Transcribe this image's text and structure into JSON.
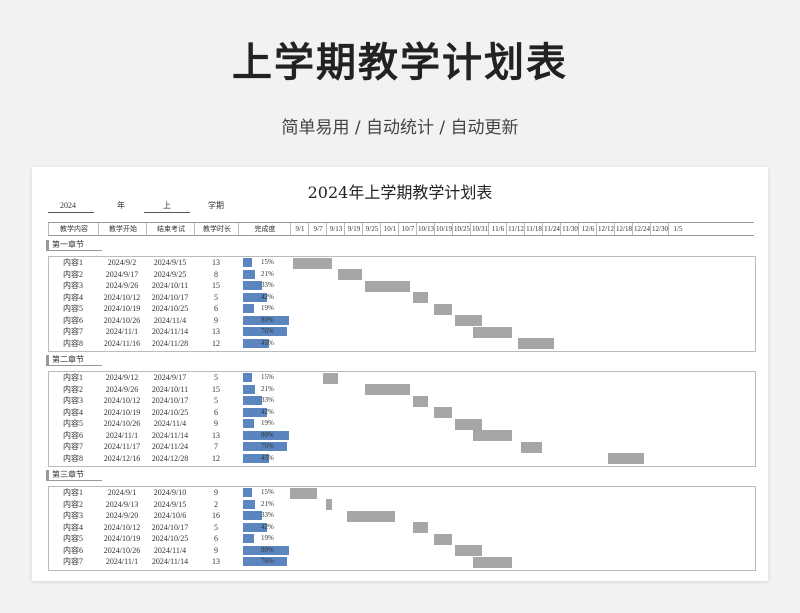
{
  "header": {
    "main_title": "上学期教学计划表",
    "subtitle": "简单易用 / 自动统计 / 自动更新"
  },
  "sheet": {
    "title": "2024年上学期教学计划表",
    "year_value": "2024",
    "year_label": "年",
    "term_value": "上",
    "term_label": "学期",
    "columns": [
      "教学内容",
      "教学开始",
      "结束考试",
      "教学时长",
      "完成度"
    ],
    "timeline_dates": [
      "9/1",
      "9/7",
      "9/13",
      "9/19",
      "9/25",
      "10/1",
      "10/7",
      "10/13",
      "10/19",
      "10/25",
      "10/31",
      "11/6",
      "11/12",
      "11/18",
      "11/24",
      "11/30",
      "12/6",
      "12/12",
      "12/18",
      "12/24",
      "12/30",
      "1/5"
    ],
    "sections": [
      {
        "name": "第一章节",
        "rows": [
          {
            "content": "内容1",
            "start": "2024/9/2",
            "end": "2024/9/15",
            "duration": "13",
            "progress": "15%",
            "progress_value": 0.15
          },
          {
            "content": "内容2",
            "start": "2024/9/17",
            "end": "2024/9/25",
            "duration": "8",
            "progress": "21%",
            "progress_value": 0.21
          },
          {
            "content": "内容3",
            "start": "2024/9/26",
            "end": "2024/10/11",
            "duration": "15",
            "progress": "33%",
            "progress_value": 0.33
          },
          {
            "content": "内容4",
            "start": "2024/10/12",
            "end": "2024/10/17",
            "duration": "5",
            "progress": "42%",
            "progress_value": 0.42
          },
          {
            "content": "内容5",
            "start": "2024/10/19",
            "end": "2024/10/25",
            "duration": "6",
            "progress": "19%",
            "progress_value": 0.19
          },
          {
            "content": "内容6",
            "start": "2024/10/26",
            "end": "2024/11/4",
            "duration": "9",
            "progress": "80%",
            "progress_value": 0.8
          },
          {
            "content": "内容7",
            "start": "2024/11/1",
            "end": "2024/11/14",
            "duration": "13",
            "progress": "76%",
            "progress_value": 0.76
          },
          {
            "content": "内容8",
            "start": "2024/11/16",
            "end": "2024/11/28",
            "duration": "12",
            "progress": "45%",
            "progress_value": 0.45
          }
        ]
      },
      {
        "name": "第二章节",
        "rows": [
          {
            "content": "内容1",
            "start": "2024/9/12",
            "end": "2024/9/17",
            "duration": "5",
            "progress": "15%",
            "progress_value": 0.15
          },
          {
            "content": "内容2",
            "start": "2024/9/26",
            "end": "2024/10/11",
            "duration": "15",
            "progress": "21%",
            "progress_value": 0.21
          },
          {
            "content": "内容3",
            "start": "2024/10/12",
            "end": "2024/10/17",
            "duration": "5",
            "progress": "33%",
            "progress_value": 0.33
          },
          {
            "content": "内容4",
            "start": "2024/10/19",
            "end": "2024/10/25",
            "duration": "6",
            "progress": "42%",
            "progress_value": 0.42
          },
          {
            "content": "内容5",
            "start": "2024/10/26",
            "end": "2024/11/4",
            "duration": "9",
            "progress": "19%",
            "progress_value": 0.19
          },
          {
            "content": "内容6",
            "start": "2024/11/1",
            "end": "2024/11/14",
            "duration": "13",
            "progress": "80%",
            "progress_value": 0.8
          },
          {
            "content": "内容7",
            "start": "2024/11/17",
            "end": "2024/11/24",
            "duration": "7",
            "progress": "76%",
            "progress_value": 0.76
          },
          {
            "content": "内容8",
            "start": "2024/12/16",
            "end": "2024/12/28",
            "duration": "12",
            "progress": "45%",
            "progress_value": 0.45
          }
        ]
      },
      {
        "name": "第三章节",
        "rows": [
          {
            "content": "内容1",
            "start": "2024/9/1",
            "end": "2024/9/10",
            "duration": "9",
            "progress": "15%",
            "progress_value": 0.15
          },
          {
            "content": "内容2",
            "start": "2024/9/13",
            "end": "2024/9/15",
            "duration": "2",
            "progress": "21%",
            "progress_value": 0.21
          },
          {
            "content": "内容3",
            "start": "2024/9/20",
            "end": "2024/10/6",
            "duration": "16",
            "progress": "33%",
            "progress_value": 0.33
          },
          {
            "content": "内容4",
            "start": "2024/10/12",
            "end": "2024/10/17",
            "duration": "5",
            "progress": "42%",
            "progress_value": 0.42
          },
          {
            "content": "内容5",
            "start": "2024/10/19",
            "end": "2024/10/25",
            "duration": "6",
            "progress": "19%",
            "progress_value": 0.19
          },
          {
            "content": "内容6",
            "start": "2024/10/26",
            "end": "2024/11/4",
            "duration": "9",
            "progress": "80%",
            "progress_value": 0.8
          },
          {
            "content": "内容7",
            "start": "2024/11/1",
            "end": "2024/11/14",
            "duration": "13",
            "progress": "76%",
            "progress_value": 0.76
          }
        ]
      }
    ],
    "colors": {
      "progress_bar": "#5b85bf",
      "gantt_bar": "#a6a6a6"
    }
  }
}
